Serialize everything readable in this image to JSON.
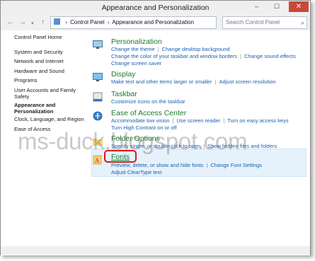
{
  "window": {
    "title": "Appearance and Personalization",
    "min": "–",
    "max": "☐",
    "close": "✕"
  },
  "addressbar": {
    "back": "←",
    "forward": "→",
    "down": "▾",
    "up": "↑",
    "crumbs": [
      "Control Panel",
      "Appearance and Personalization"
    ],
    "separator": "›",
    "dropdown": "▾",
    "refresh": "↻",
    "search_placeholder": "Search Control Panel",
    "search_icon": "⌕"
  },
  "nav": [
    "Control Panel Home",
    "System and Security",
    "Network and Internet",
    "Hardware and Sound",
    "Programs",
    "User Accounts and Family",
    "Safety",
    "Appearance and",
    "Personalization",
    "Clock, Language, and Region",
    "Ease of Access"
  ],
  "categories": [
    {
      "heading": "Personalization",
      "icon": "personalization-icon",
      "lines": [
        [
          "Change the theme",
          "Change desktop background"
        ],
        [
          "Change the color of your taskbar and window borders",
          "Change sound effects"
        ],
        [
          "Change screen saver"
        ]
      ]
    },
    {
      "heading": "Display",
      "icon": "display-icon",
      "lines": [
        [
          "Make text and other items larger or smaller",
          "Adjust screen resolution"
        ]
      ]
    },
    {
      "heading": "Taskbar",
      "icon": "taskbar-icon",
      "lines": [
        [
          "Customize icons on the taskbar"
        ]
      ]
    },
    {
      "heading": "Ease of Access Center",
      "icon": "ease-of-access-icon",
      "lines": [
        [
          "Accommodate low vision",
          "Use screen reader",
          "Turn on easy access keys"
        ],
        [
          "Turn High Contrast on or off"
        ]
      ]
    },
    {
      "heading": "Folder Options",
      "icon": "folder-icon",
      "lines": [
        [
          "Specify single- or double-click to open",
          "Show hidden files and folders"
        ]
      ]
    },
    {
      "heading": "Fonts",
      "icon": "fonts-icon",
      "lines": [
        [
          "Preview, delete, or show and hide fonts",
          "Change Font Settings"
        ],
        [
          "Adjust ClearType text"
        ]
      ]
    }
  ],
  "watermark": "ms-duck.blogspot.com",
  "colors": {
    "link": "#1a5fb4",
    "heading": "#1a7a2c",
    "highlight": "#e5f1fb",
    "annotation": "#d9181a"
  }
}
